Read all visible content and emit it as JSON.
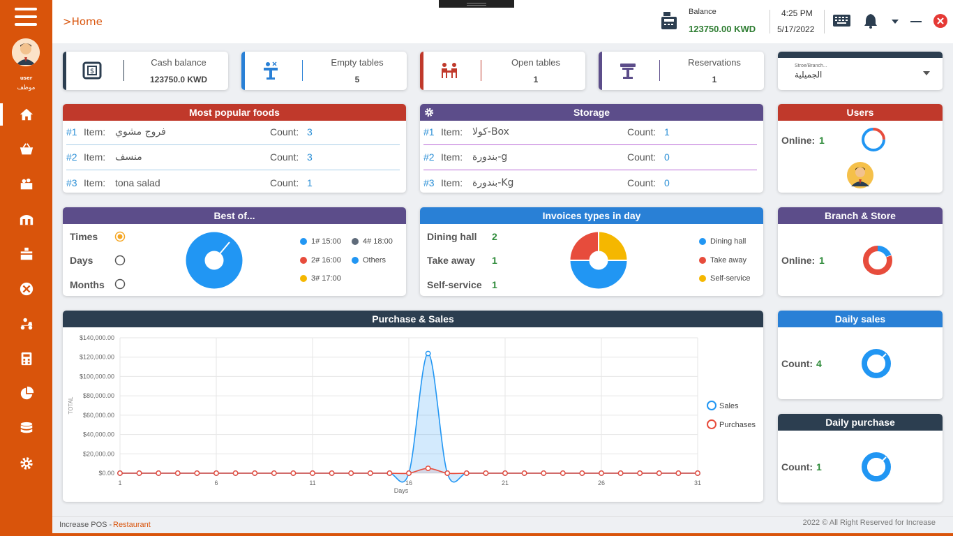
{
  "app": {
    "breadcrumb": ">Home",
    "footer_app": "Increase POS - ",
    "footer_module": "Restaurant",
    "footer_copyright": "2022 © All Right Reserved for Increase"
  },
  "user": {
    "name": "user",
    "role": "موظف"
  },
  "nav": [
    {
      "icon": "home-icon",
      "active": true
    },
    {
      "icon": "basket-icon"
    },
    {
      "icon": "products-icon"
    },
    {
      "icon": "store-icon"
    },
    {
      "icon": "table-icon"
    },
    {
      "icon": "utensils-icon"
    },
    {
      "icon": "delivery-icon"
    },
    {
      "icon": "calculator-icon"
    },
    {
      "icon": "pie-chart-icon"
    },
    {
      "icon": "database-icon"
    },
    {
      "icon": "gear-icon"
    }
  ],
  "header": {
    "balance_label": "Balance",
    "balance_value": "123750.00 KWD",
    "time": "4:25 PM",
    "date": "5/17/2022"
  },
  "stats": [
    {
      "label": "Cash balance",
      "value": "123750.0 KWD",
      "color": "#2c3e50",
      "icon": "cash-register-icon"
    },
    {
      "label": "Empty tables",
      "value": "5",
      "color": "#2980d6",
      "icon": "empty-table-icon"
    },
    {
      "label": "Open tables",
      "value": "1",
      "color": "#c0392b",
      "icon": "dining-table-icon"
    },
    {
      "label": "Reservations",
      "value": "1",
      "color": "#5c4d8a",
      "icon": "reservation-icon"
    }
  ],
  "branch_select": {
    "label": "Stroe/Branch...",
    "value": "الجميلية"
  },
  "popular_foods": {
    "title": "Most popular foods",
    "item_label": "Item:",
    "count_label": "Count:",
    "items": [
      {
        "rank": "#1",
        "name": "فروج مشوي",
        "count": "3"
      },
      {
        "rank": "#2",
        "name": "منسف",
        "count": "3"
      },
      {
        "rank": "#3",
        "name": "tona salad",
        "count": "1"
      }
    ]
  },
  "storage": {
    "title": "Storage",
    "item_label": "Item:",
    "count_label": "Count:",
    "items": [
      {
        "rank": "#1",
        "name": "كولا-Box",
        "count": "1"
      },
      {
        "rank": "#2",
        "name": "بندورة-g",
        "count": "0"
      },
      {
        "rank": "#3",
        "name": "بندورة-Kg",
        "count": "0"
      }
    ]
  },
  "users_card": {
    "title": "Users",
    "online_label": "Online:",
    "online_value": "1"
  },
  "best_of": {
    "title": "Best of...",
    "options": [
      "Times",
      "Days",
      "Months"
    ],
    "selected": "Times",
    "legend": [
      {
        "label": "1# 15:00",
        "color": "#2196f3"
      },
      {
        "label": "4# 18:00",
        "color": "#5f6b7a"
      },
      {
        "label": "2# 16:00",
        "color": "#e74c3c"
      },
      {
        "label": "Others",
        "color": "#2196f3"
      },
      {
        "label": "3# 17:00",
        "color": "#f5b700"
      }
    ]
  },
  "invoices": {
    "title": "Invoices types in day",
    "rows": [
      {
        "label": "Dining hall",
        "value": "2"
      },
      {
        "label": "Take away",
        "value": "1"
      },
      {
        "label": "Self-service",
        "value": "1"
      }
    ],
    "legend": [
      {
        "label": "Dining hall",
        "color": "#2196f3"
      },
      {
        "label": "Take away",
        "color": "#e74c3c"
      },
      {
        "label": "Self-service",
        "color": "#f5b700"
      }
    ]
  },
  "branch_store": {
    "title": "Branch & Store",
    "online_label": "Online:",
    "online_value": "1"
  },
  "daily_sales": {
    "title": "Daily sales",
    "count_label": "Count:",
    "count_value": "4"
  },
  "daily_purchase": {
    "title": "Daily purchase",
    "count_label": "Count:",
    "count_value": "1"
  },
  "chart_data": {
    "type": "line",
    "title": "Purchase & Sales",
    "xlabel": "Days",
    "ylabel": "TOTAL",
    "ylim": [
      0,
      140000
    ],
    "yticks": [
      "$0.00",
      "$20,000.00",
      "$40,000.00",
      "$60,000.00",
      "$80,000.00",
      "$100,000.00",
      "$120,000.00",
      "$140,000.00"
    ],
    "xticks": [
      "1",
      "6",
      "11",
      "16",
      "21",
      "26",
      "31"
    ],
    "x": [
      1,
      2,
      3,
      4,
      5,
      6,
      7,
      8,
      9,
      10,
      11,
      12,
      13,
      14,
      15,
      16,
      17,
      18,
      19,
      20,
      21,
      22,
      23,
      24,
      25,
      26,
      27,
      28,
      29,
      30,
      31
    ],
    "series": [
      {
        "name": "Sales",
        "color": "#2196f3",
        "values": [
          0,
          0,
          0,
          0,
          0,
          0,
          0,
          0,
          0,
          0,
          0,
          0,
          0,
          0,
          0,
          0,
          123750,
          0,
          0,
          0,
          0,
          0,
          0,
          0,
          0,
          0,
          0,
          0,
          0,
          0,
          0
        ]
      },
      {
        "name": "Purchases",
        "color": "#e74c3c",
        "values": [
          0,
          0,
          0,
          0,
          0,
          0,
          0,
          0,
          0,
          0,
          0,
          0,
          0,
          0,
          0,
          0,
          5000,
          0,
          0,
          0,
          0,
          0,
          0,
          0,
          0,
          0,
          0,
          0,
          0,
          0,
          0
        ]
      }
    ],
    "legend_position": "right",
    "grid": true
  }
}
